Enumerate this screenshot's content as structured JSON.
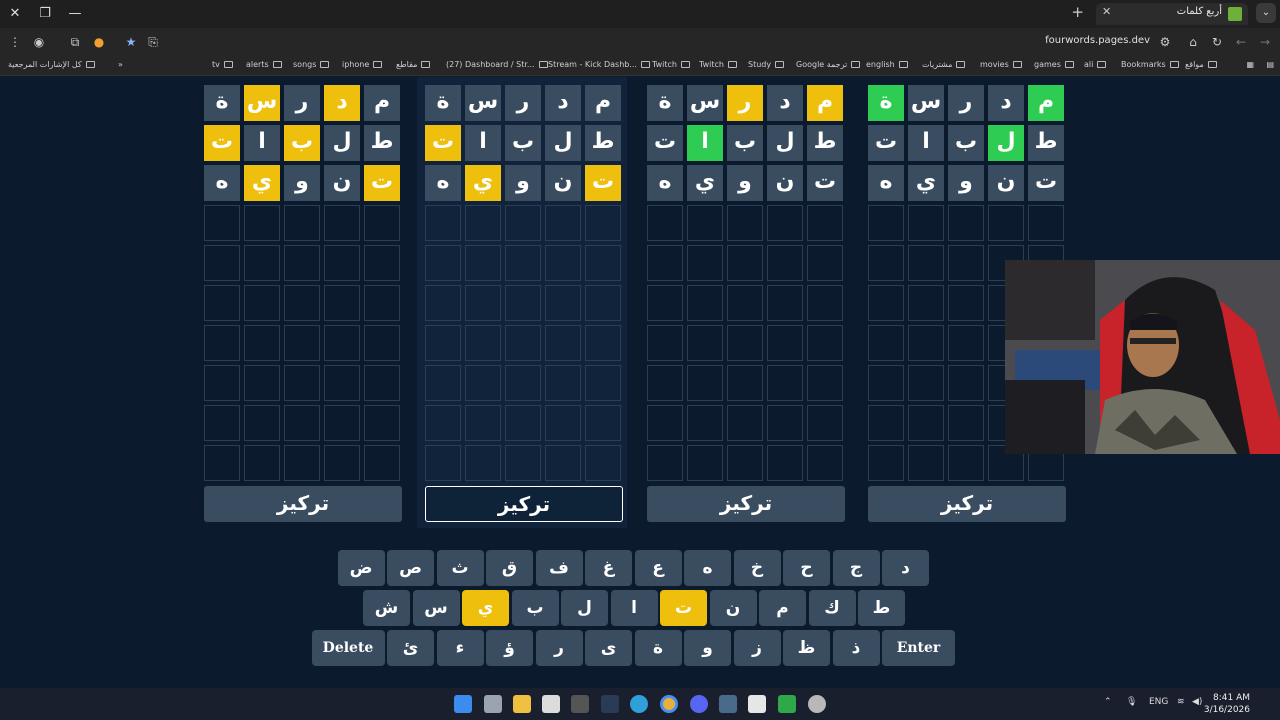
{
  "browser": {
    "tab_title": "أربع كلمات",
    "url": "fourwords.pages.dev",
    "bookmarks": [
      "مواقع",
      "Bookmarks",
      "ali",
      "games",
      "movies",
      "مشتريات",
      "english",
      "Google ترجمة",
      "Study",
      "Twitch",
      "Twitch",
      "Stream - Kick Dashb...",
      "(27) Dashboard / Str...",
      "مقاطع",
      "iphone",
      "songs",
      "alerts",
      "tv"
    ],
    "all_bookmarks": "كل الإشارات المرجعية"
  },
  "boards": [
    {
      "rows": [
        [
          {
            "l": "م",
            "s": "filled"
          },
          {
            "l": "د",
            "s": "yellow"
          },
          {
            "l": "ر",
            "s": "filled"
          },
          {
            "l": "س",
            "s": "yellow"
          },
          {
            "l": "ة",
            "s": "filled"
          }
        ],
        [
          {
            "l": "ط",
            "s": "filled"
          },
          {
            "l": "ل",
            "s": "filled"
          },
          {
            "l": "ب",
            "s": "yellow"
          },
          {
            "l": "ا",
            "s": "filled"
          },
          {
            "l": "ت",
            "s": "yellow"
          }
        ],
        [
          {
            "l": "ت",
            "s": "yellow"
          },
          {
            "l": "ن",
            "s": "filled"
          },
          {
            "l": "و",
            "s": "filled"
          },
          {
            "l": "ي",
            "s": "yellow"
          },
          {
            "l": "ه",
            "s": "filled"
          }
        ]
      ]
    },
    {
      "rows": [
        [
          {
            "l": "م",
            "s": "filled"
          },
          {
            "l": "د",
            "s": "filled"
          },
          {
            "l": "ر",
            "s": "filled"
          },
          {
            "l": "س",
            "s": "filled"
          },
          {
            "l": "ة",
            "s": "filled"
          }
        ],
        [
          {
            "l": "ط",
            "s": "filled"
          },
          {
            "l": "ل",
            "s": "filled"
          },
          {
            "l": "ب",
            "s": "filled"
          },
          {
            "l": "ا",
            "s": "filled"
          },
          {
            "l": "ت",
            "s": "yellow"
          }
        ],
        [
          {
            "l": "ت",
            "s": "yellow"
          },
          {
            "l": "ن",
            "s": "filled"
          },
          {
            "l": "و",
            "s": "filled"
          },
          {
            "l": "ي",
            "s": "yellow"
          },
          {
            "l": "ه",
            "s": "filled"
          }
        ]
      ]
    },
    {
      "rows": [
        [
          {
            "l": "م",
            "s": "yellow"
          },
          {
            "l": "د",
            "s": "filled"
          },
          {
            "l": "ر",
            "s": "yellow"
          },
          {
            "l": "س",
            "s": "filled"
          },
          {
            "l": "ة",
            "s": "filled"
          }
        ],
        [
          {
            "l": "ط",
            "s": "filled"
          },
          {
            "l": "ل",
            "s": "filled"
          },
          {
            "l": "ب",
            "s": "filled"
          },
          {
            "l": "ا",
            "s": "green"
          },
          {
            "l": "ت",
            "s": "filled"
          }
        ],
        [
          {
            "l": "ت",
            "s": "filled"
          },
          {
            "l": "ن",
            "s": "filled"
          },
          {
            "l": "و",
            "s": "filled"
          },
          {
            "l": "ي",
            "s": "filled"
          },
          {
            "l": "ه",
            "s": "filled"
          }
        ]
      ]
    },
    {
      "rows": [
        [
          {
            "l": "م",
            "s": "green"
          },
          {
            "l": "د",
            "s": "filled"
          },
          {
            "l": "ر",
            "s": "filled"
          },
          {
            "l": "س",
            "s": "filled"
          },
          {
            "l": "ة",
            "s": "green"
          }
        ],
        [
          {
            "l": "ط",
            "s": "filled"
          },
          {
            "l": "ل",
            "s": "green"
          },
          {
            "l": "ب",
            "s": "filled"
          },
          {
            "l": "ا",
            "s": "filled"
          },
          {
            "l": "ت",
            "s": "filled"
          }
        ],
        [
          {
            "l": "ت",
            "s": "filled"
          },
          {
            "l": "ن",
            "s": "filled"
          },
          {
            "l": "و",
            "s": "filled"
          },
          {
            "l": "ي",
            "s": "filled"
          },
          {
            "l": "ه",
            "s": "filled"
          }
        ]
      ]
    }
  ],
  "total_rows": 10,
  "focused_board": 1,
  "focus_label": "تركيز",
  "keyboard": {
    "row1": [
      {
        "k": "د"
      },
      {
        "k": "ج"
      },
      {
        "k": "ح"
      },
      {
        "k": "خ"
      },
      {
        "k": "ه"
      },
      {
        "k": "ع"
      },
      {
        "k": "غ"
      },
      {
        "k": "ف"
      },
      {
        "k": "ق"
      },
      {
        "k": "ث"
      },
      {
        "k": "ص"
      },
      {
        "k": "ض"
      }
    ],
    "row2": [
      {
        "k": "ط"
      },
      {
        "k": "ك"
      },
      {
        "k": "م"
      },
      {
        "k": "ن"
      },
      {
        "k": "ت",
        "s": "yellow"
      },
      {
        "k": "ا"
      },
      {
        "k": "ل"
      },
      {
        "k": "ب"
      },
      {
        "k": "ي",
        "s": "yellow"
      },
      {
        "k": "س"
      },
      {
        "k": "ش"
      }
    ],
    "row3": [
      {
        "k": "Enter",
        "wide": true
      },
      {
        "k": "ذ"
      },
      {
        "k": "ظ"
      },
      {
        "k": "ز"
      },
      {
        "k": "و"
      },
      {
        "k": "ة"
      },
      {
        "k": "ى"
      },
      {
        "k": "ر"
      },
      {
        "k": "ؤ"
      },
      {
        "k": "ء"
      },
      {
        "k": "ئ"
      },
      {
        "k": "Delete",
        "wide": true
      }
    ]
  },
  "taskbar": {
    "language": "ENG",
    "time": "8:41 AM",
    "date": "3/16/2026"
  },
  "colors": {
    "yellow": "#efbf0d",
    "green": "#2ecc52",
    "tile": "#3a4d60",
    "background": "#0b1a2c"
  }
}
